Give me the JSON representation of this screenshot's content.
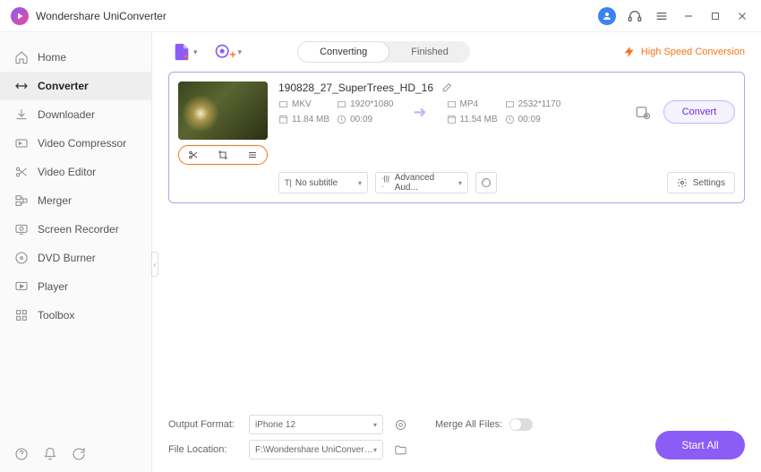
{
  "app": {
    "title": "Wondershare UniConverter"
  },
  "sidebar": {
    "items": [
      {
        "label": "Home"
      },
      {
        "label": "Converter"
      },
      {
        "label": "Downloader"
      },
      {
        "label": "Video Compressor"
      },
      {
        "label": "Video Editor"
      },
      {
        "label": "Merger"
      },
      {
        "label": "Screen Recorder"
      },
      {
        "label": "DVD Burner"
      },
      {
        "label": "Player"
      },
      {
        "label": "Toolbox"
      }
    ]
  },
  "toolbar": {
    "tabs": {
      "converting": "Converting",
      "finished": "Finished"
    },
    "highspeed": "High Speed Conversion"
  },
  "file": {
    "name": "190828_27_SuperTrees_HD_16",
    "source": {
      "format": "MKV",
      "resolution": "1920*1080",
      "size": "11.84 MB",
      "duration": "00:09"
    },
    "target": {
      "format": "MP4",
      "resolution": "2532*1170",
      "size": "11.54 MB",
      "duration": "00:09"
    },
    "subtitle": "No subtitle",
    "audio": "Advanced Aud...",
    "settings_label": "Settings",
    "convert_label": "Convert"
  },
  "footer": {
    "output_format_label": "Output Format:",
    "output_format_value": "iPhone 12",
    "file_location_label": "File Location:",
    "file_location_value": "F:\\Wondershare UniConverter",
    "merge_label": "Merge All Files:",
    "start_all": "Start All"
  }
}
